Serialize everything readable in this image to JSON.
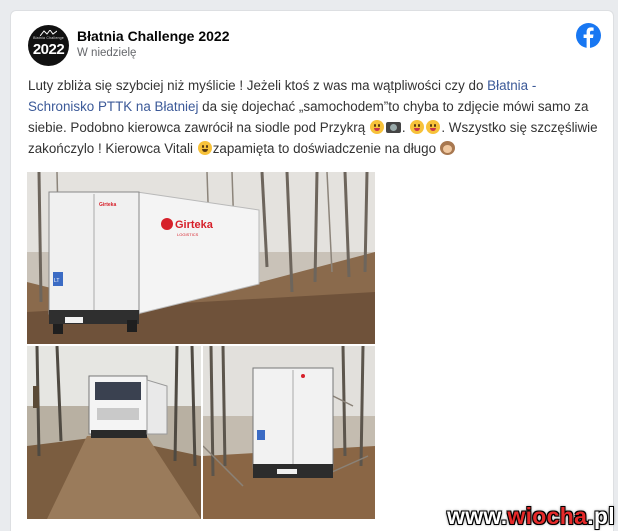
{
  "post": {
    "page_name": "Błatnia Challenge 2022",
    "date": "W niedzielę",
    "avatar": {
      "tiny_text": "Błatnia Challenge",
      "year": "2022"
    },
    "text": {
      "part1": "Luty zbliża się szybciej niż myślicie ! Jeżeli ktoś z was ma wątpliwości czy do ",
      "link": "Błatnia - Schronisko PTTK na Błatniej",
      "part2": " da się dojechać „samochodem”to chyba to zdjęcie mówi samo za siebie. Podobno kierowca zawrócił na siodle pod Przykrą ",
      "part3": ". ",
      "part4": ". Wszystko się szczęśliwie zakończylo ! Kierowca Vitali ",
      "part5": "zapamięta to doświadczenie na długo "
    },
    "photos": {
      "main_trailer_brand": "Girteka",
      "main_trailer_sub": "LOGISTICS",
      "main_plate": "LT"
    }
  },
  "watermark": {
    "prefix": "www.",
    "highlight": "wiocha",
    "suffix": ".pl"
  },
  "colors": {
    "link": "#3b5998",
    "facebook_blue": "#1877f2",
    "brand_red": "#d6202a",
    "watermark_red": "#e62a2a"
  },
  "icons": [
    "facebook-logo-icon",
    "grinning-tongue-emoji-icon",
    "camera-emoji-icon",
    "winking-tongue-emoji-icon",
    "crying-emoji-icon",
    "see-no-evil-monkey-emoji-icon"
  ]
}
